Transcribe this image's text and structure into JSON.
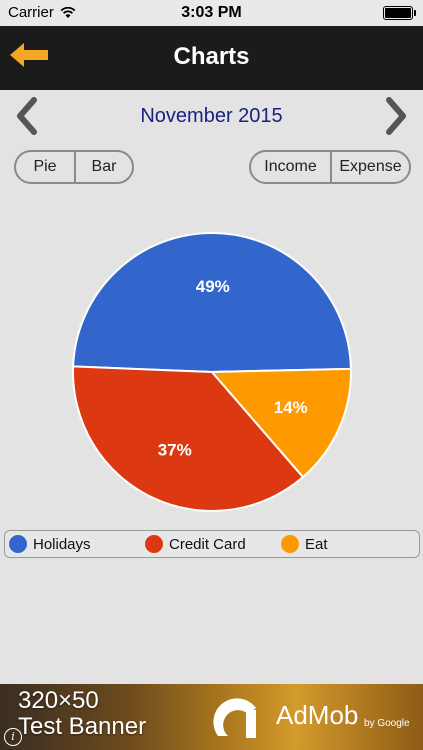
{
  "status_bar": {
    "carrier": "Carrier",
    "time": "3:03 PM"
  },
  "nav": {
    "title": "Charts",
    "back_icon": "back-arrow-icon"
  },
  "month_nav": {
    "month": "November 2015"
  },
  "chart_type_toggle": {
    "options": [
      "Pie",
      "Bar"
    ]
  },
  "transaction_type_toggle": {
    "options": [
      "Income",
      "Expense"
    ]
  },
  "chart_data": {
    "type": "pie",
    "categories": [
      "Holidays",
      "Credit Card",
      "Eat"
    ],
    "values": [
      49,
      37,
      14
    ],
    "labels": [
      "49%",
      "37%",
      "14%"
    ],
    "colors": [
      "#3366cc",
      "#dc3912",
      "#ff9900"
    ],
    "legend_position": "bottom"
  },
  "ad": {
    "line1": "320×50",
    "line2": "Test Banner",
    "brand": "AdMob",
    "by": "by Google",
    "info": "i"
  }
}
